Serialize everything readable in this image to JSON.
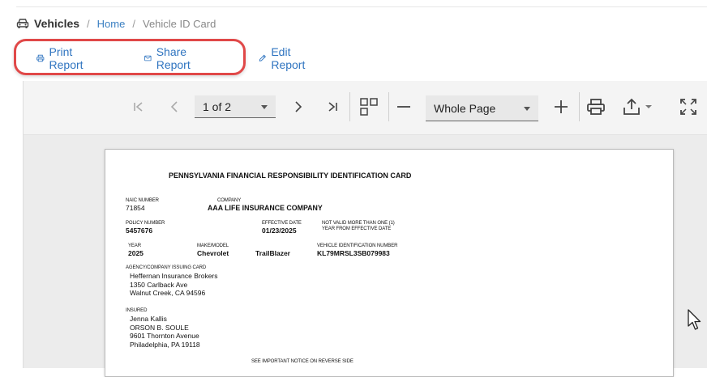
{
  "breadcrumb": {
    "title": "Vehicles",
    "home": "Home",
    "current": "Vehicle ID Card",
    "separator": "/"
  },
  "actions": {
    "print": "Print Report",
    "share": "Share Report",
    "edit": "Edit Report"
  },
  "toolbar": {
    "page_select": "1 of 2",
    "zoom_select": "Whole Page"
  },
  "card": {
    "title": "PENNSYLVANIA FINANCIAL RESPONSIBILITY IDENTIFICATION CARD",
    "naic_label": "NAIC NUMBER",
    "naic": "71854",
    "company_label": "COMPANY",
    "company": "AAA LIFE INSURANCE COMPANY",
    "policy_label": "POLICY NUMBER",
    "policy": "5457676",
    "effective_label": "EFFECTIVE DATE",
    "effective": "01/23/2025",
    "valid_note_1": "NOT VALID MORE THAN ONE (1)",
    "valid_note_2": "YEAR FROM EFFECTIVE DATE",
    "year_label": "YEAR",
    "year": "2025",
    "make_label": "MAKE/MODEL",
    "make": "Chevrolet",
    "model": "TrailBlazer",
    "vin_label": "VEHICLE IDENTIFICATION NUMBER",
    "vin": "KL79MRSL3SB079983",
    "agency_label": "AGENCY/COMPANY ISSUING CARD",
    "agency_lines": [
      "Heffernan Insurance Brokers",
      "1350 Carlback Ave",
      "Walnut Creek, CA 94596"
    ],
    "insured_label": "INSURED",
    "insured_lines": [
      "Jenna Kallis",
      "ORSON B. SOULE",
      "9601 Thornton Avenue",
      "Philadelphia, PA 19118"
    ],
    "notice": "SEE IMPORTANT NOTICE ON REVERSE SIDE"
  },
  "colors": {
    "accent": "#2f74c0",
    "highlight": "#e04848"
  }
}
